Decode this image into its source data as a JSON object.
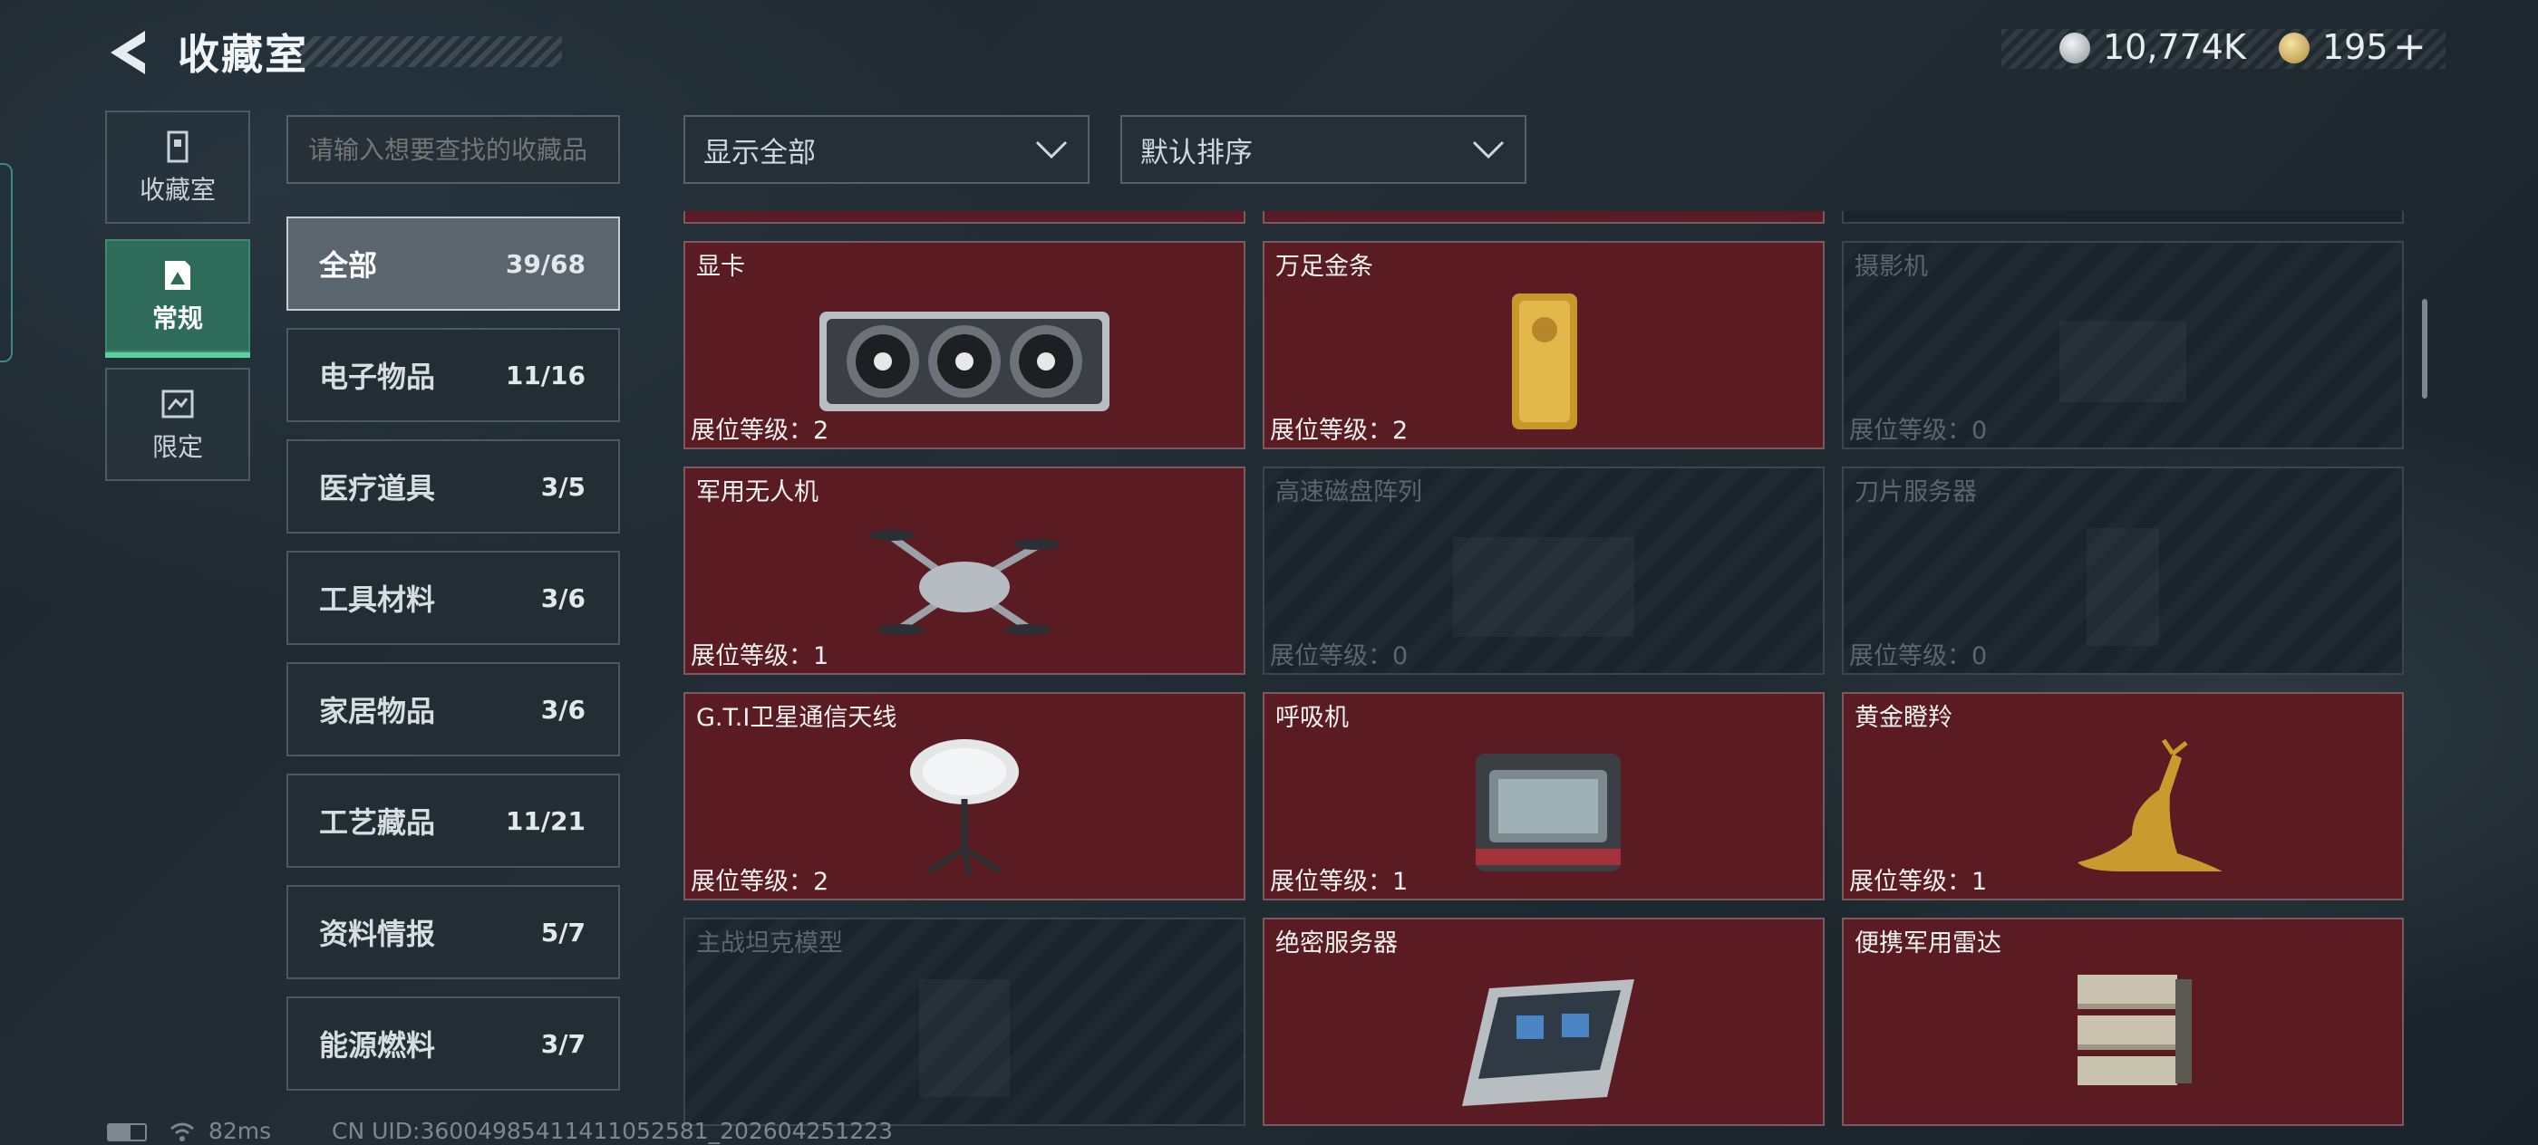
{
  "header": {
    "title": "收藏室",
    "currency1": "10,774K",
    "currency2": "195",
    "plus": "+"
  },
  "side_tabs": [
    {
      "label": "收藏室",
      "icon": "collection-room-icon"
    },
    {
      "label": "常规",
      "icon": "regular-icon",
      "active": true
    },
    {
      "label": "限定",
      "icon": "limited-icon"
    }
  ],
  "search": {
    "placeholder": "请输入想要查找的收藏品"
  },
  "filters": {
    "display": "显示全部",
    "sort": "默认排序"
  },
  "categories": [
    {
      "label": "全部",
      "count": "39/68"
    },
    {
      "label": "电子物品",
      "count": "11/16"
    },
    {
      "label": "医疗道具",
      "count": "3/5"
    },
    {
      "label": "工具材料",
      "count": "3/6"
    },
    {
      "label": "家居物品",
      "count": "3/6"
    },
    {
      "label": "工艺藏品",
      "count": "11/21"
    },
    {
      "label": "资料情报",
      "count": "5/7"
    },
    {
      "label": "能源燃料",
      "count": "3/7"
    }
  ],
  "items": [
    {
      "name": "显卡",
      "level": "展位等级：2",
      "unlocked": true,
      "icon": "graphics-card-icon"
    },
    {
      "name": "万足金条",
      "level": "展位等级：2",
      "unlocked": true,
      "icon": "gold-bar-icon"
    },
    {
      "name": "摄影机",
      "level": "展位等级：0",
      "unlocked": false,
      "icon": "camera-icon"
    },
    {
      "name": "军用无人机",
      "level": "展位等级：1",
      "unlocked": true,
      "icon": "drone-icon"
    },
    {
      "name": "高速磁盘阵列",
      "level": "展位等级：0",
      "unlocked": false,
      "icon": "disk-array-icon"
    },
    {
      "name": "刀片服务器",
      "level": "展位等级：0",
      "unlocked": false,
      "icon": "blade-server-icon"
    },
    {
      "name": "G.T.I卫星通信天线",
      "level": "展位等级：2",
      "unlocked": true,
      "icon": "satellite-antenna-icon"
    },
    {
      "name": "呼吸机",
      "level": "展位等级：1",
      "unlocked": true,
      "icon": "ventilator-icon"
    },
    {
      "name": "黄金瞪羚",
      "level": "展位等级：1",
      "unlocked": true,
      "icon": "golden-gazelle-icon"
    },
    {
      "name": "主战坦克模型",
      "level": "",
      "unlocked": false,
      "icon": "tank-model-icon"
    },
    {
      "name": "绝密服务器",
      "level": "",
      "unlocked": true,
      "icon": "secret-server-icon"
    },
    {
      "name": "便携军用雷达",
      "level": "",
      "unlocked": true,
      "icon": "portable-radar-icon"
    }
  ],
  "status": {
    "ping": "82ms",
    "uid": "CN UID:36004985411411052581_202604251223"
  },
  "colors": {
    "accent": "#59d39e",
    "card_unlocked": "#5a1c22",
    "card_locked": "#1b242a"
  }
}
